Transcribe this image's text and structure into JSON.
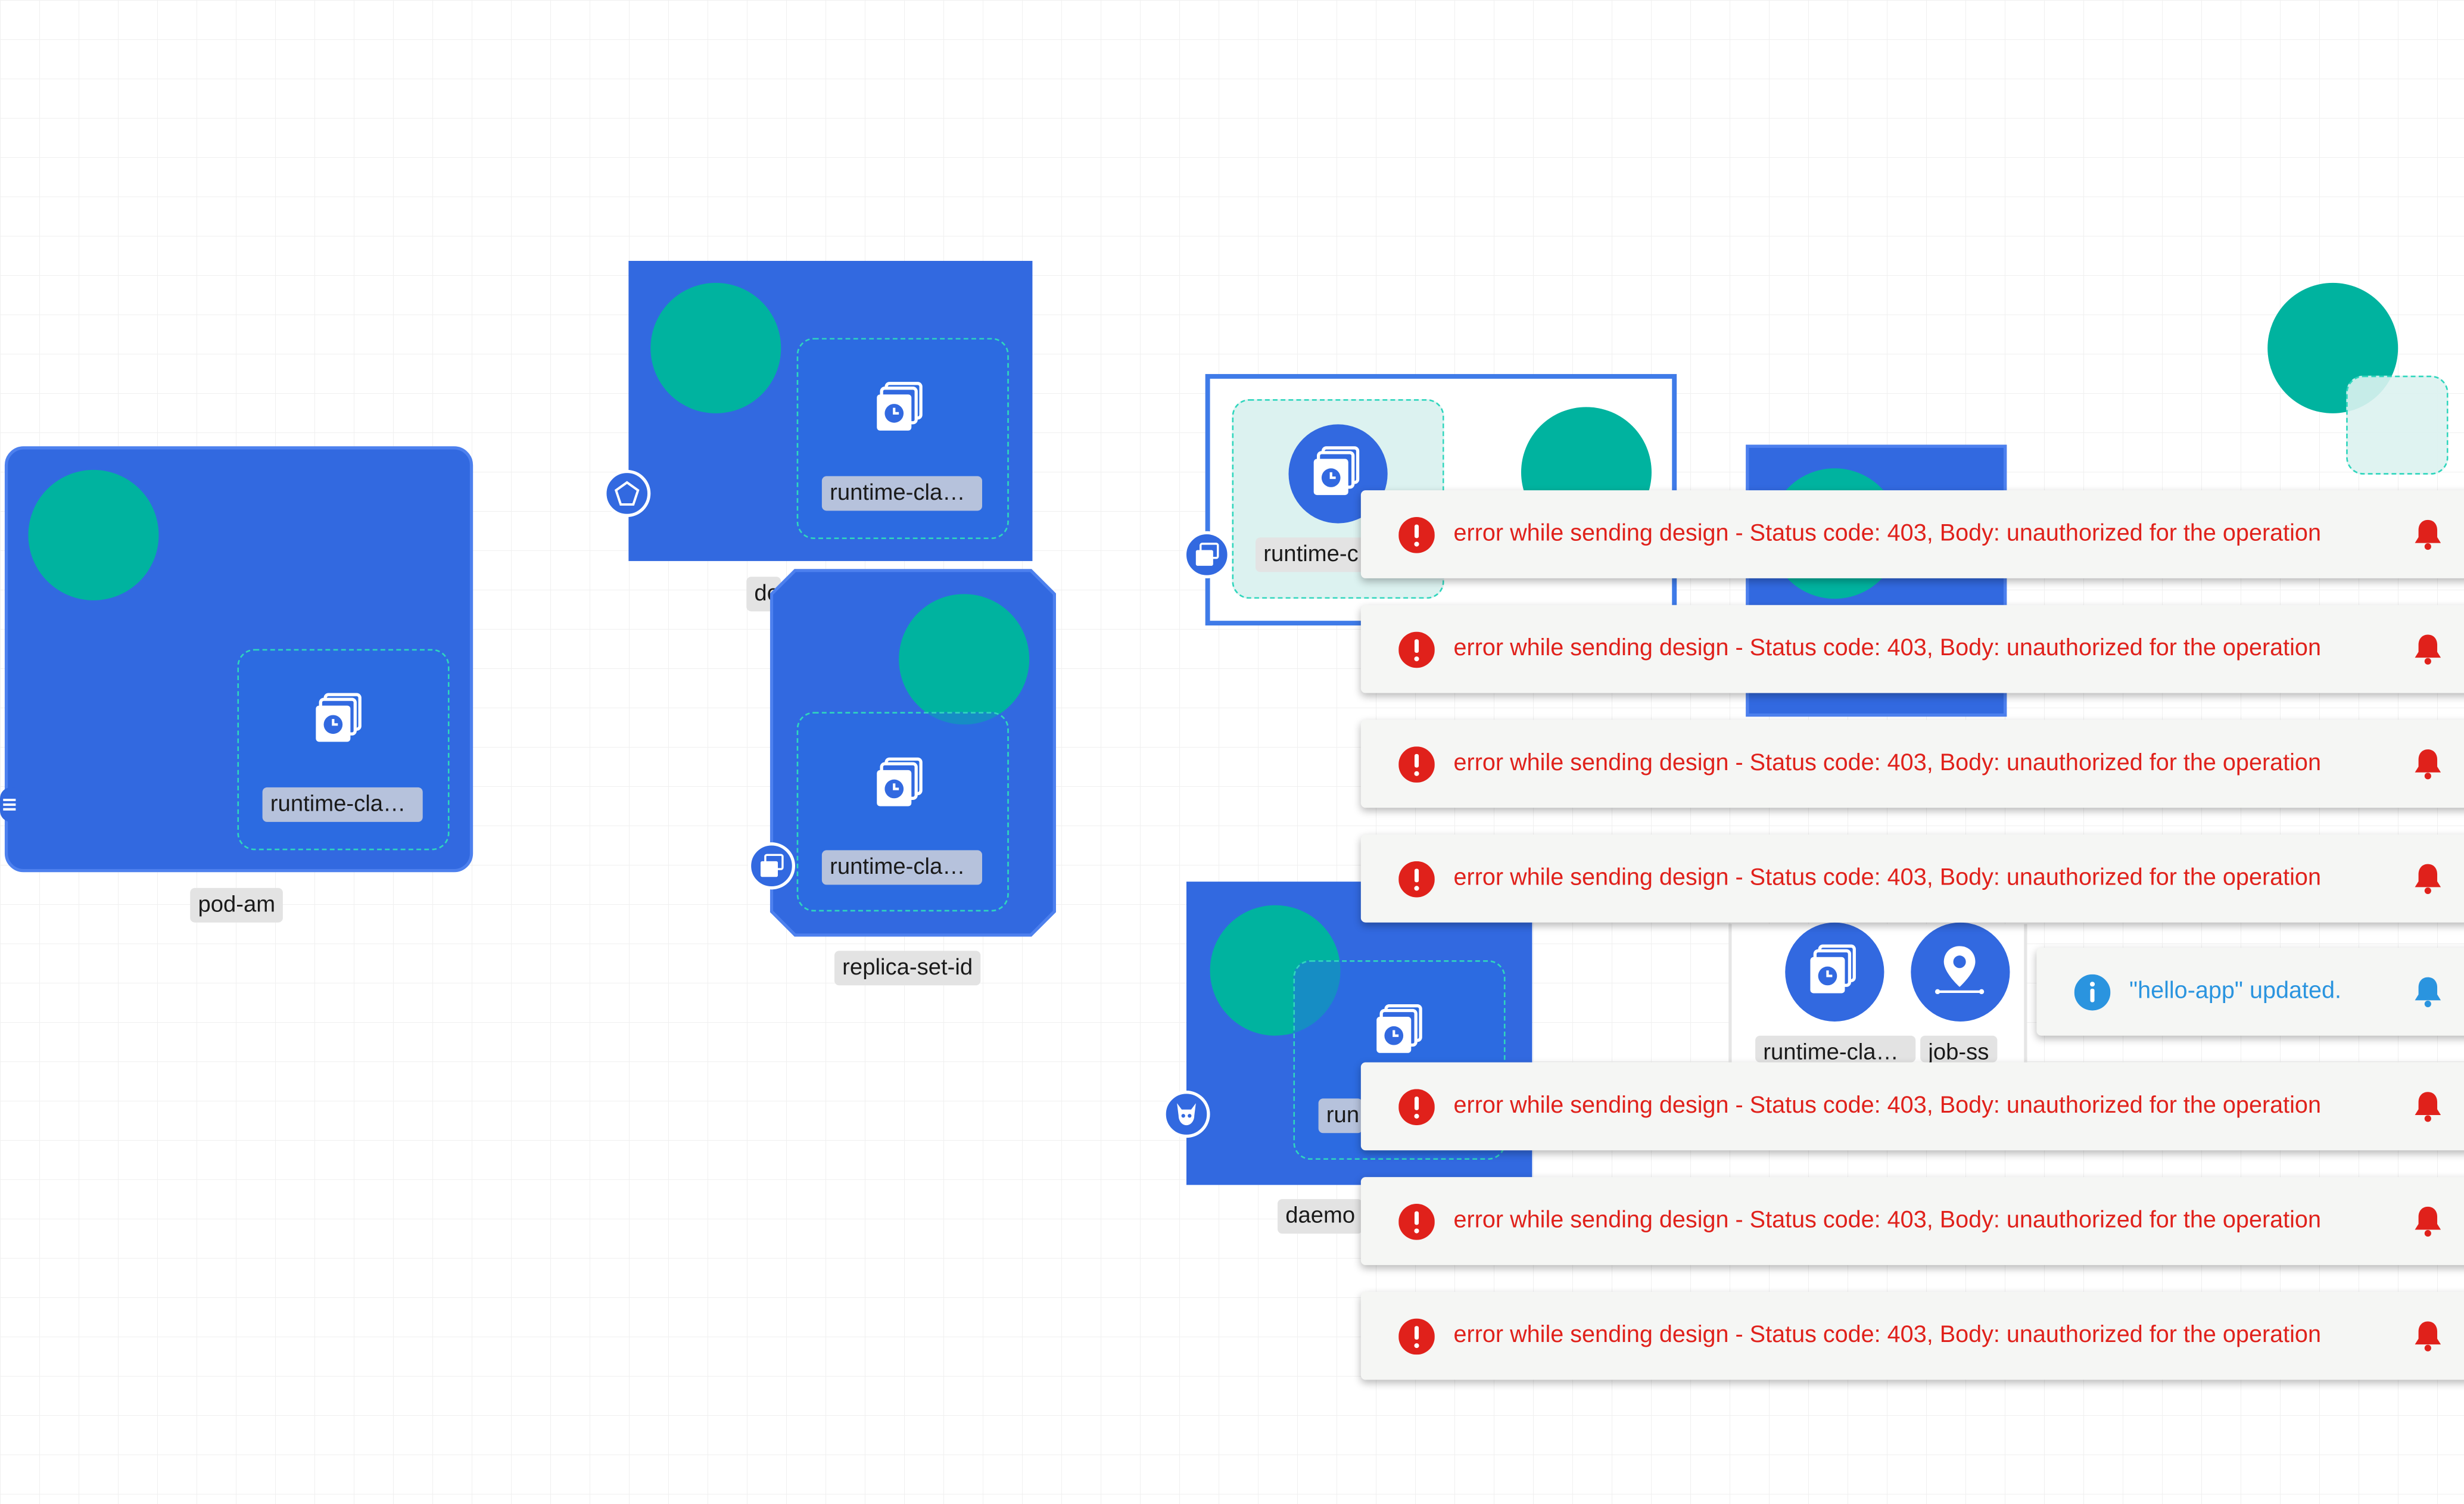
{
  "colors": {
    "node_fill": "#3269e0",
    "node_circle": "#00b39f",
    "dashed_border": "#2fd6bd",
    "error_text": "#e0211b",
    "info_text": "#2a94df",
    "toast_bg": "#f5f6f4"
  },
  "canvas": {
    "nodes": [
      {
        "id": "pod",
        "label": "pod-am",
        "inner_label": "runtime-cla…",
        "icon": "runtime-class-icon",
        "badge_icon": "pod-icon"
      },
      {
        "id": "deployment",
        "label": "de",
        "inner_label": "runtime-cla…",
        "icon": "runtime-class-icon",
        "badge_icon": "deployment-icon"
      },
      {
        "id": "replicaset",
        "label": "replica-set-id",
        "inner_label": "runtime-cla…",
        "icon": "runtime-class-icon",
        "badge_icon": "replicaset-icon"
      },
      {
        "id": "group",
        "inner_label": "runtime-c",
        "icon": "runtime-class-icon",
        "badge_icon": "container-icon"
      },
      {
        "id": "daemonset",
        "label": "daemo",
        "inner_label": "run",
        "icon": "runtime-class-icon",
        "badge_icon": "daemon-icon"
      },
      {
        "id": "job",
        "icon_labels": [
          "runtime-cla…",
          "job-ss"
        ],
        "icons": [
          "runtime-class-icon",
          "location-pin-icon"
        ]
      }
    ]
  },
  "notifications": [
    {
      "type": "error",
      "icon": "error-circle-icon",
      "message": "error while sending design - Status code: 403, Body: unauthorized for the operation",
      "action_icon": "bell-icon"
    },
    {
      "type": "error",
      "icon": "error-circle-icon",
      "message": "error while sending design - Status code: 403, Body: unauthorized for the operation",
      "action_icon": "bell-icon"
    },
    {
      "type": "error",
      "icon": "error-circle-icon",
      "message": "error while sending design - Status code: 403, Body: unauthorized for the operation",
      "action_icon": "bell-icon"
    },
    {
      "type": "error",
      "icon": "error-circle-icon",
      "message": "error while sending design - Status code: 403, Body: unauthorized for the operation",
      "action_icon": "bell-icon"
    },
    {
      "type": "info",
      "icon": "info-circle-icon",
      "message": "\"hello-app\" updated.",
      "action_icon": "bell-icon"
    },
    {
      "type": "error",
      "icon": "error-circle-icon",
      "message": "error while sending design - Status code: 403, Body: unauthorized for the operation",
      "action_icon": "bell-icon"
    },
    {
      "type": "error",
      "icon": "error-circle-icon",
      "message": "error while sending design - Status code: 403, Body: unauthorized for the operation",
      "action_icon": "bell-icon"
    },
    {
      "type": "error",
      "icon": "error-circle-icon",
      "message": "error while sending design - Status code: 403, Body: unauthorized for the operation",
      "action_icon": "bell-icon"
    }
  ]
}
